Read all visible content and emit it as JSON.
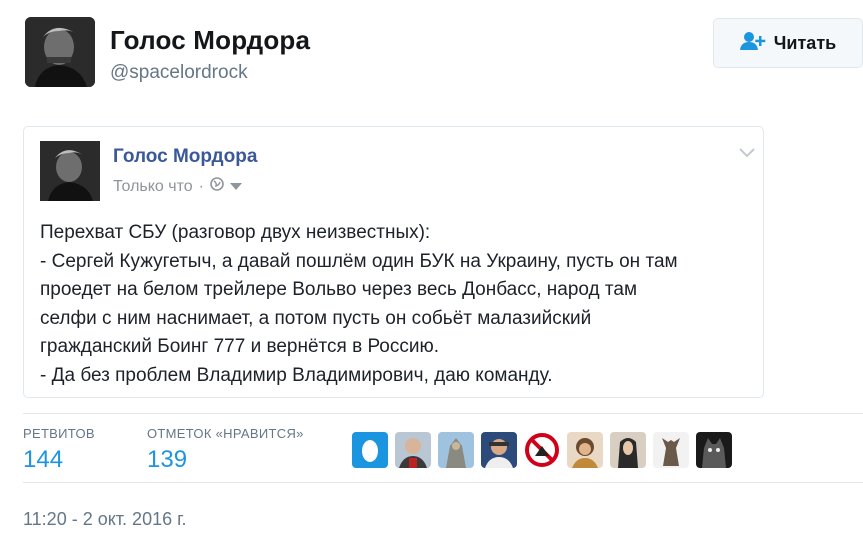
{
  "header": {
    "display_name": "Голос Мордора",
    "handle": "@spacelordrock",
    "follow_label": "Читать"
  },
  "embed": {
    "author": "Голос Мордора",
    "time": "Только что",
    "meta_sep": "·",
    "lines": [
      "Перехват СБУ (разговор двух неизвестных):",
      "- Сергей Кужугетыч, а давай пошлём один БУК на Украину, пусть он там",
      "проедет на белом трейлере Вольво через весь Донбасс, народ там",
      "селфи с ним наснимает, а потом пусть он собьёт малазийский",
      "гражданский Боинг 777 и вернётся в Россию.",
      "- Да без проблем Владимир Владимирович, даю команду."
    ]
  },
  "stats": {
    "retweets_label": "РЕТВИТОВ",
    "retweets_value": "144",
    "likes_label": "ОТМЕТОК «НРАВИТСЯ»",
    "likes_value": "139"
  },
  "timestamp": "11:20 - 2 окт. 2016 г.",
  "colors": {
    "link_blue": "#1b95e0",
    "fb_blue": "#3b5998",
    "muted": "#657786"
  }
}
